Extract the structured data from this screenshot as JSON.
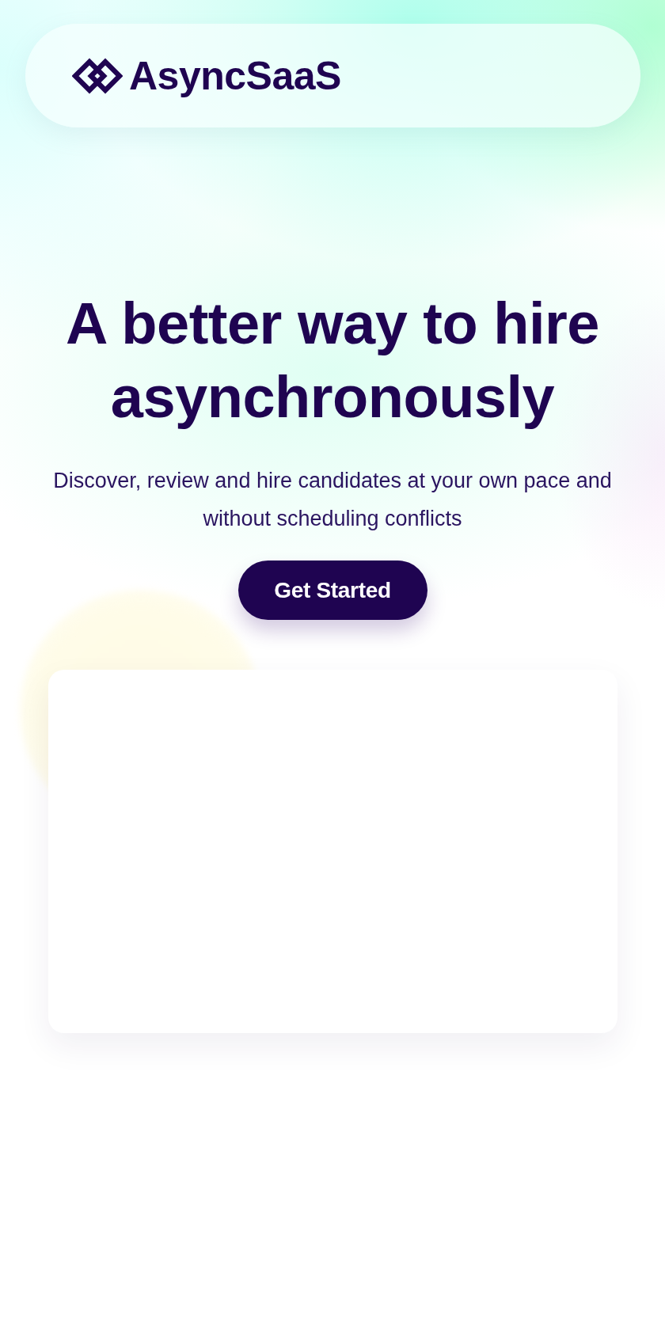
{
  "header": {
    "logo": {
      "name": "AsyncSaaS"
    }
  },
  "hero": {
    "title": "A better way to hire asynchronously",
    "subtitle": "Discover, review and hire candidates at your own pace and without scheduling conflicts",
    "cta": {
      "label": "Get Started"
    }
  }
}
